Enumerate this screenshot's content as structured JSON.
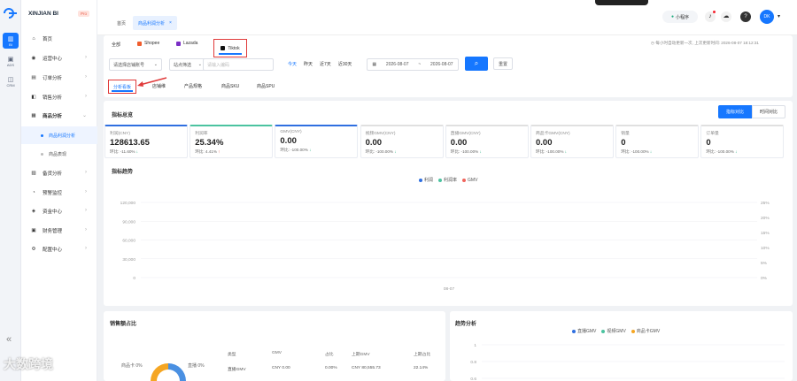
{
  "brand": {
    "name": "XINJIAN BI",
    "badge": "Pro"
  },
  "rail": [
    {
      "label": "BI"
    },
    {
      "label": "ADS"
    },
    {
      "label": "CRM"
    }
  ],
  "menu": {
    "home": "首页",
    "ops": "运营中心",
    "orders": "订单分析",
    "sales": "销售分析",
    "goods": "商品分析",
    "goods_sub": [
      "商品利润分析",
      "商品表现"
    ],
    "stock": "备货分析",
    "warn": "预警监控",
    "finance": "资金中心",
    "fin_manage": "财务管理",
    "config": "配置中心"
  },
  "header": {
    "tab_home": "首页",
    "tab_active": "商品利润分析",
    "mini_program": "小程序",
    "avatar": "DK"
  },
  "platforms": {
    "all": "全部",
    "items": [
      "Shopee",
      "Lazada",
      "Tiktok"
    ],
    "note": "每小时自动更新一次, 上次更新时间: 2026-08-07 18:12:31"
  },
  "filters": {
    "shop_placeholder": "请选择店铺账号",
    "site": "站点筛选",
    "sku_placeholder": "请输入编码",
    "quick": [
      "今天",
      "昨天",
      "近7天",
      "近30天"
    ],
    "date_from": "2026-08-07",
    "date_sep": "~",
    "date_to": "2026-08-07",
    "reset": "重置"
  },
  "subtabs": [
    "分析看板",
    "店铺维",
    "产品规格",
    "商品SKU",
    "商品SPU"
  ],
  "summary": {
    "title": "指标总览",
    "toggle": [
      "指标对比",
      "时间对比"
    ]
  },
  "kpis": [
    {
      "label": "利润(CNY)",
      "value": "128613.65",
      "ratio": "环比: -11.60%",
      "dir": "down"
    },
    {
      "label": "利润率",
      "value": "25.34%",
      "ratio": "环比: 4.41%",
      "dir": "up"
    },
    {
      "label": "GMV(CNY)",
      "value": "0.00",
      "ratio": "环比: -100.00%",
      "dir": "down"
    },
    {
      "label": "视频GMV(CNY)",
      "value": "0.00",
      "ratio": "环比: -100.00%",
      "dir": "down"
    },
    {
      "label": "直播GMV(CNY)",
      "value": "0.00",
      "ratio": "环比: -100.00%",
      "dir": "down"
    },
    {
      "label": "商品卡GMV(CNY)",
      "value": "0.00",
      "ratio": "环比: -100.00%",
      "dir": "down"
    },
    {
      "label": "销量",
      "value": "0",
      "ratio": "环比: -100.00%",
      "dir": "down"
    },
    {
      "label": "订单量",
      "value": "0",
      "ratio": "环比: -100.00%",
      "dir": "down"
    }
  ],
  "chart_data": [
    {
      "type": "line",
      "title": "指标趋势",
      "x": [
        "08-07"
      ],
      "series": [
        {
          "name": "利润",
          "color": "#2f6fe0"
        },
        {
          "name": "利润率",
          "color": "#4cc3a0"
        },
        {
          "name": "GMV",
          "color": "#f0655d"
        }
      ],
      "y_left_ticks": [
        "120,000",
        "90,000",
        "60,000",
        "30,000",
        "0"
      ],
      "y_right_ticks": [
        "25%",
        "20%",
        "15%",
        "10%",
        "5%",
        "0%"
      ],
      "grid": true,
      "legend": "top-center"
    },
    {
      "type": "pie",
      "title": "销售额占比",
      "labels": [
        {
          "name": "商品卡",
          "value": "0%"
        },
        {
          "name": "直播",
          "value": "0%"
        }
      ]
    },
    {
      "type": "line",
      "title": "趋势分析",
      "series": [
        {
          "name": "直播GMV",
          "color": "#2f6fe0"
        },
        {
          "name": "视频GMV",
          "color": "#4cc3a0"
        },
        {
          "name": "商品卡GMV",
          "color": "#f5a623"
        }
      ],
      "y_ticks": [
        "1",
        "0.8",
        "0.6"
      ]
    }
  ],
  "table": {
    "headers": [
      "类型",
      "GMV",
      "占比",
      "上期GMV",
      "上期占比"
    ],
    "row": [
      "直播GMV",
      "CNY 0.00",
      "0.00%",
      "CNY 80,555.73",
      "22.14%"
    ]
  },
  "watermark": "大数跨境"
}
